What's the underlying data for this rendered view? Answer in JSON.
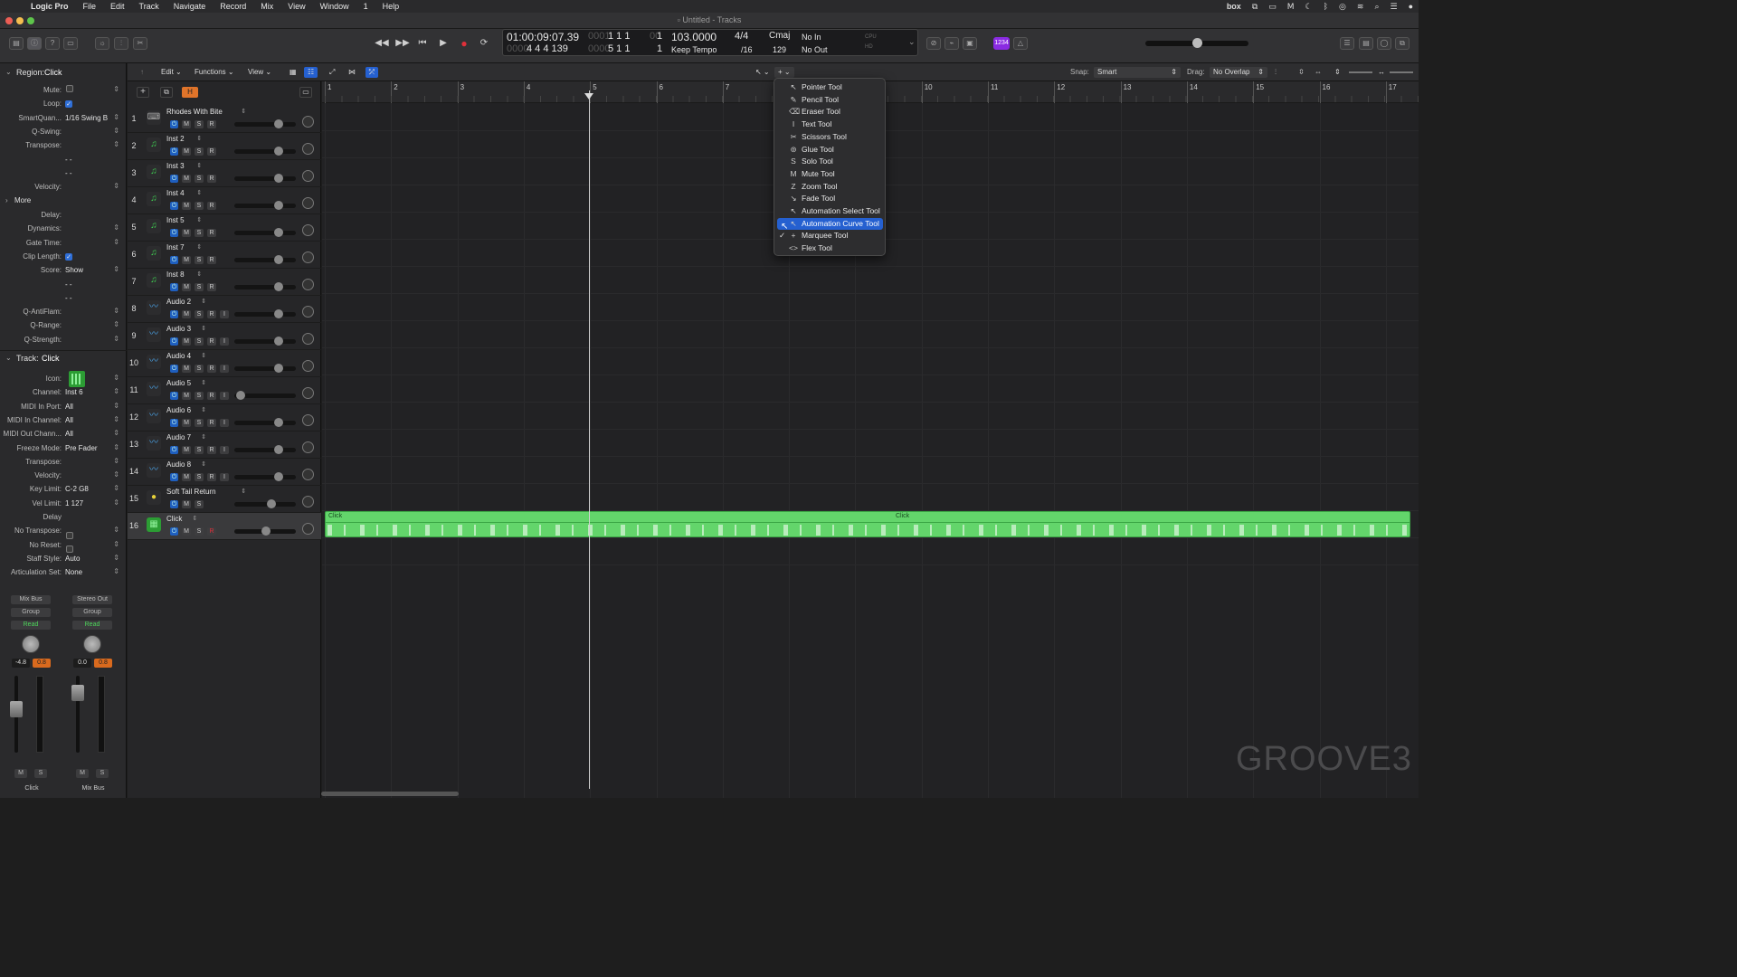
{
  "menubar": {
    "apple": "",
    "items": [
      "Logic Pro",
      "File",
      "Edit",
      "Track",
      "Navigate",
      "Record",
      "Mix",
      "View",
      "Window",
      "1",
      "Help"
    ],
    "right_box": "box"
  },
  "window": {
    "title": "Untitled - Tracks"
  },
  "lcd": {
    "time": "01:00:09:07.39",
    "bars_top": "1  1  1",
    "bars_top_sub": "1",
    "bars_top_prefix": "0001",
    "bars_bottom": "4  4  4  139",
    "bars_bottom_prefix": "0000",
    "bars_bottom2": "5  1  1",
    "bars_bottom2_sub": "1",
    "tempo": "103.0000",
    "tempo_mode": "Keep Tempo",
    "signature": "4/4",
    "division": "/16",
    "key": "Cmaj",
    "key_num": "129",
    "in": "No In",
    "out": "No Out",
    "counter_badge": "1234"
  },
  "inspector": {
    "region_header": "Region:",
    "region_name": "Click",
    "rows": [
      {
        "label": "Mute:",
        "value": ""
      },
      {
        "label": "Loop:",
        "value": "✓"
      },
      {
        "label": "SmartQuan...",
        "value": "1/16 Swing B"
      },
      {
        "label": "Q-Swing:",
        "value": ""
      },
      {
        "label": "Transpose:",
        "value": ""
      },
      {
        "label": "",
        "value": "- -"
      },
      {
        "label": "",
        "value": "- -"
      },
      {
        "label": "Velocity:",
        "value": ""
      }
    ],
    "more_label": "More",
    "more_rows": [
      {
        "label": "Delay:",
        "value": ""
      },
      {
        "label": "Dynamics:",
        "value": ""
      },
      {
        "label": "Gate Time:",
        "value": ""
      },
      {
        "label": "Clip Length:",
        "value": "✓"
      },
      {
        "label": "Score:",
        "value": "Show"
      },
      {
        "label": "",
        "value": "- -"
      },
      {
        "label": "",
        "value": "- -"
      },
      {
        "label": "Q-AntiFlam:",
        "value": ""
      },
      {
        "label": "Q-Range:",
        "value": ""
      },
      {
        "label": "Q-Strength:",
        "value": ""
      }
    ],
    "track_header": "Track:",
    "track_name": "Click",
    "track_rows": [
      {
        "label": "Icon:",
        "value": ""
      },
      {
        "label": "Channel:",
        "value": "Inst 6"
      },
      {
        "label": "MIDI In Port:",
        "value": "All"
      },
      {
        "label": "MIDI In Channel:",
        "value": "All"
      },
      {
        "label": "MIDI Out Chann...",
        "value": "All"
      },
      {
        "label": "Freeze Mode:",
        "value": "Pre Fader"
      },
      {
        "label": "Transpose:",
        "value": ""
      },
      {
        "label": "Velocity:",
        "value": ""
      },
      {
        "label": "Key Limit:",
        "value": "C-2  G8"
      },
      {
        "label": "Vel Limit:",
        "value": "1  127"
      },
      {
        "label": "Delay",
        "value": ""
      },
      {
        "label": "No Transpose:",
        "value": ""
      },
      {
        "label": "No Reset:",
        "value": ""
      },
      {
        "label": "Staff Style:",
        "value": "Auto"
      },
      {
        "label": "Articulation Set:",
        "value": "None"
      }
    ]
  },
  "strips": [
    {
      "top": "Mix Bus",
      "group": "Group",
      "read": "Read",
      "vol": "-4.8",
      "peak": "0.8",
      "m": "M",
      "s": "S",
      "name": "Click"
    },
    {
      "top": "Stereo Out",
      "group": "Group",
      "read": "Read",
      "vol": "0.0",
      "peak": "0.8",
      "m": "M",
      "s": "S",
      "name": "Mix Bus"
    }
  ],
  "trackbar": {
    "edit": "Edit",
    "functions": "Functions",
    "view": "View",
    "snap_label": "Snap:",
    "snap": "Smart",
    "drag_label": "Drag:",
    "drag": "No Overlap"
  },
  "tracks": [
    {
      "n": "1",
      "name": "Rhodes With Bite",
      "icon": "keyboard",
      "color": "#aaaaaa",
      "i": false
    },
    {
      "n": "2",
      "name": "Inst 2",
      "icon": "note",
      "color": "#3fd152",
      "i": false
    },
    {
      "n": "3",
      "name": "Inst 3",
      "icon": "note",
      "color": "#3fd152",
      "i": false
    },
    {
      "n": "4",
      "name": "Inst 4",
      "icon": "note",
      "color": "#3fd152",
      "i": false
    },
    {
      "n": "5",
      "name": "Inst 5",
      "icon": "note",
      "color": "#3fd152",
      "i": false
    },
    {
      "n": "6",
      "name": "Inst 7",
      "icon": "note",
      "color": "#3fd152",
      "i": false
    },
    {
      "n": "7",
      "name": "Inst 8",
      "icon": "note",
      "color": "#3fd152",
      "i": false
    },
    {
      "n": "8",
      "name": "Audio 2",
      "icon": "wave",
      "color": "#4aa3e8",
      "i": true
    },
    {
      "n": "9",
      "name": "Audio 3",
      "icon": "wave",
      "color": "#4aa3e8",
      "i": true
    },
    {
      "n": "10",
      "name": "Audio 4",
      "icon": "wave",
      "color": "#4aa3e8",
      "i": true
    },
    {
      "n": "11",
      "name": "Audio 5",
      "icon": "wave",
      "color": "#4aa3e8",
      "i": true
    },
    {
      "n": "12",
      "name": "Audio 6",
      "icon": "wave",
      "color": "#4aa3e8",
      "i": true
    },
    {
      "n": "13",
      "name": "Audio 7",
      "icon": "wave",
      "color": "#4aa3e8",
      "i": true
    },
    {
      "n": "14",
      "name": "Audio 8",
      "icon": "wave",
      "color": "#4aa3e8",
      "i": true
    },
    {
      "n": "15",
      "name": "Soft Tail Return",
      "icon": "bus",
      "color": "#e8d23a",
      "i": false
    },
    {
      "n": "16",
      "name": "Click",
      "icon": "click",
      "color": "#3fd152",
      "i": false
    }
  ],
  "bars": [
    "1",
    "2",
    "3",
    "4",
    "5",
    "6",
    "7",
    "8",
    "9",
    "10",
    "11",
    "12",
    "13",
    "14",
    "15",
    "16",
    "17"
  ],
  "region": {
    "name": "Click",
    "name2": "Click"
  },
  "tool_menu": {
    "items": [
      {
        "key": "↖",
        "label": "Pointer Tool"
      },
      {
        "key": "✎",
        "label": "Pencil Tool"
      },
      {
        "key": "⌫",
        "label": "Eraser Tool"
      },
      {
        "key": "I",
        "label": "Text Tool"
      },
      {
        "key": "✂",
        "label": "Scissors Tool"
      },
      {
        "key": "⊚",
        "label": "Glue Tool"
      },
      {
        "key": "S",
        "label": "Solo Tool"
      },
      {
        "key": "M",
        "label": "Mute Tool"
      },
      {
        "key": "Z",
        "label": "Zoom Tool"
      },
      {
        "key": "↘",
        "label": "Fade Tool"
      },
      {
        "key": "↖",
        "label": "Automation Select Tool"
      },
      {
        "key": "↖",
        "label": "Automation Curve Tool"
      },
      {
        "key": "+",
        "label": "Marquee Tool"
      },
      {
        "key": "<>",
        "label": "Flex Tool"
      }
    ],
    "selected": "Automation Curve Tool",
    "checked": "Marquee Tool"
  },
  "watermark": "GROOVE3",
  "colors": {
    "accent": "#2560d0",
    "region": "#63d56b",
    "record": "#e0303a"
  }
}
